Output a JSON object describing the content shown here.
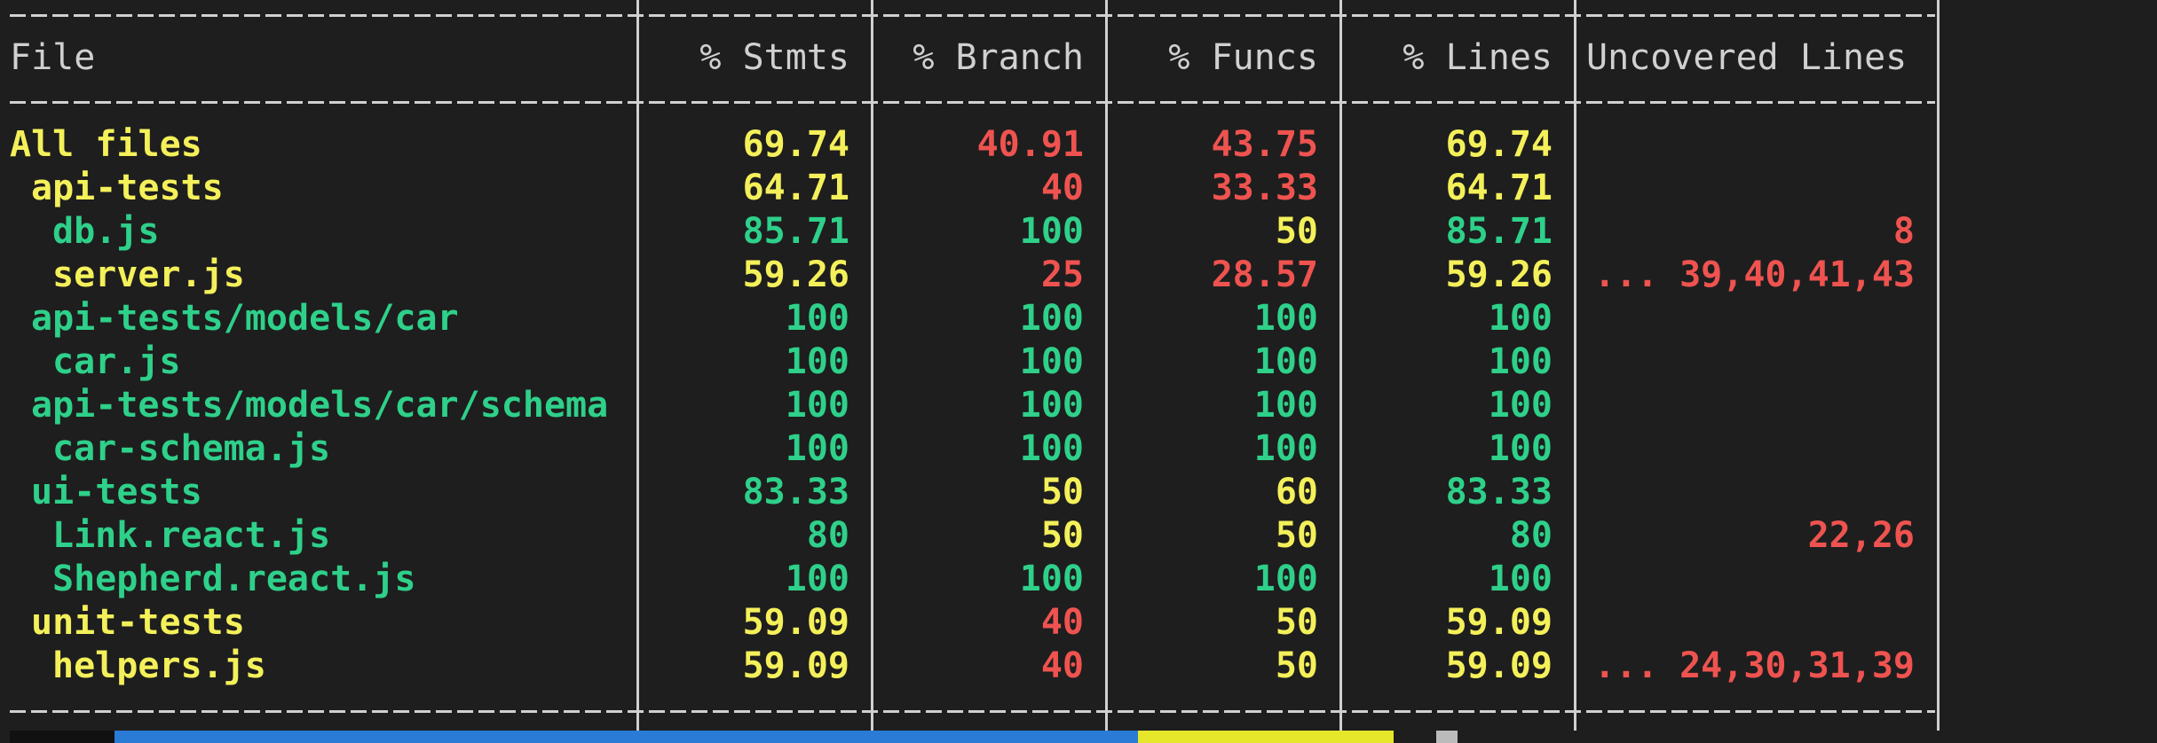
{
  "header": {
    "file": "File",
    "stmts": "% Stmts",
    "branch": "% Branch",
    "funcs": "% Funcs",
    "lines": "% Lines",
    "uncovered": "Uncovered Lines"
  },
  "rows": [
    {
      "file": "All files",
      "indent": 0,
      "file_color": "yellow",
      "stmts": "69.74",
      "stmts_color": "yellow",
      "branch": "40.91",
      "branch_color": "red",
      "funcs": "43.75",
      "funcs_color": "red",
      "lines": "69.74",
      "lines_color": "yellow",
      "uncovered": ""
    },
    {
      "file": "api-tests",
      "indent": 1,
      "file_color": "yellow",
      "stmts": "64.71",
      "stmts_color": "yellow",
      "branch": "40",
      "branch_color": "red",
      "funcs": "33.33",
      "funcs_color": "red",
      "lines": "64.71",
      "lines_color": "yellow",
      "uncovered": ""
    },
    {
      "file": "db.js",
      "indent": 2,
      "file_color": "green",
      "stmts": "85.71",
      "stmts_color": "green",
      "branch": "100",
      "branch_color": "green",
      "funcs": "50",
      "funcs_color": "yellow",
      "lines": "85.71",
      "lines_color": "green",
      "uncovered": "8"
    },
    {
      "file": "server.js",
      "indent": 2,
      "file_color": "yellow",
      "stmts": "59.26",
      "stmts_color": "yellow",
      "branch": "25",
      "branch_color": "red",
      "funcs": "28.57",
      "funcs_color": "red",
      "lines": "59.26",
      "lines_color": "yellow",
      "uncovered": "... 39,40,41,43"
    },
    {
      "file": "api-tests/models/car",
      "indent": 1,
      "file_color": "green",
      "stmts": "100",
      "stmts_color": "green",
      "branch": "100",
      "branch_color": "green",
      "funcs": "100",
      "funcs_color": "green",
      "lines": "100",
      "lines_color": "green",
      "uncovered": ""
    },
    {
      "file": "car.js",
      "indent": 2,
      "file_color": "green",
      "stmts": "100",
      "stmts_color": "green",
      "branch": "100",
      "branch_color": "green",
      "funcs": "100",
      "funcs_color": "green",
      "lines": "100",
      "lines_color": "green",
      "uncovered": ""
    },
    {
      "file": "api-tests/models/car/schema",
      "indent": 1,
      "file_color": "green",
      "stmts": "100",
      "stmts_color": "green",
      "branch": "100",
      "branch_color": "green",
      "funcs": "100",
      "funcs_color": "green",
      "lines": "100",
      "lines_color": "green",
      "uncovered": ""
    },
    {
      "file": "car-schema.js",
      "indent": 2,
      "file_color": "green",
      "stmts": "100",
      "stmts_color": "green",
      "branch": "100",
      "branch_color": "green",
      "funcs": "100",
      "funcs_color": "green",
      "lines": "100",
      "lines_color": "green",
      "uncovered": ""
    },
    {
      "file": "ui-tests",
      "indent": 1,
      "file_color": "green",
      "stmts": "83.33",
      "stmts_color": "green",
      "branch": "50",
      "branch_color": "yellow",
      "funcs": "60",
      "funcs_color": "yellow",
      "lines": "83.33",
      "lines_color": "green",
      "uncovered": ""
    },
    {
      "file": "Link.react.js",
      "indent": 2,
      "file_color": "green",
      "stmts": "80",
      "stmts_color": "green",
      "branch": "50",
      "branch_color": "yellow",
      "funcs": "50",
      "funcs_color": "yellow",
      "lines": "80",
      "lines_color": "green",
      "uncovered": "22,26"
    },
    {
      "file": "Shepherd.react.js",
      "indent": 2,
      "file_color": "green",
      "stmts": "100",
      "stmts_color": "green",
      "branch": "100",
      "branch_color": "green",
      "funcs": "100",
      "funcs_color": "green",
      "lines": "100",
      "lines_color": "green",
      "uncovered": ""
    },
    {
      "file": "unit-tests",
      "indent": 1,
      "file_color": "yellow",
      "stmts": "59.09",
      "stmts_color": "yellow",
      "branch": "40",
      "branch_color": "red",
      "funcs": "50",
      "funcs_color": "yellow",
      "lines": "59.09",
      "lines_color": "yellow",
      "uncovered": ""
    },
    {
      "file": "helpers.js",
      "indent": 2,
      "file_color": "yellow",
      "stmts": "59.09",
      "stmts_color": "yellow",
      "branch": "40",
      "branch_color": "red",
      "funcs": "50",
      "funcs_color": "yellow",
      "lines": "59.09",
      "lines_color": "yellow",
      "uncovered": "... 24,30,31,39"
    }
  ],
  "colors": {
    "background": "#1e1e1e",
    "text": "#d0d0d0",
    "yellow": "#f4f05a",
    "red": "#ef5350",
    "green": "#2ed08a",
    "statusbar_blue": "#2a7bd6",
    "statusbar_yellow": "#e6e62a",
    "statusbar_dark": "#111111",
    "statusbar_grey": "#bbbbbb"
  }
}
